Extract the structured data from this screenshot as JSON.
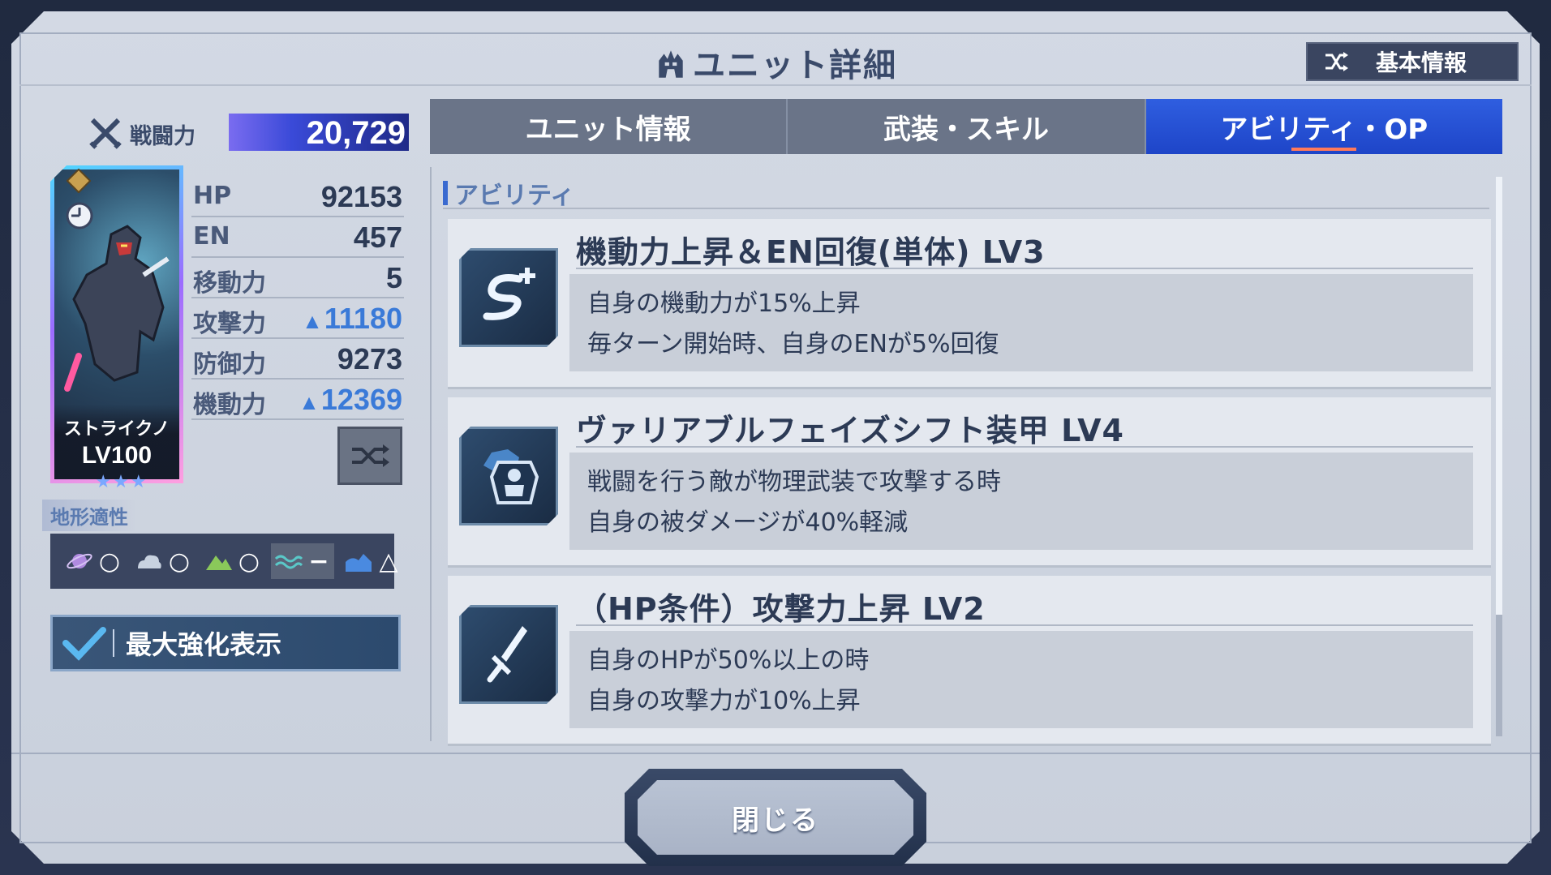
{
  "header": {
    "title": "ユニット詳細",
    "basic_info_label": "基本情報"
  },
  "power": {
    "label": "戦闘力",
    "value": "20,729"
  },
  "unit": {
    "name": "ストライクノ",
    "level": "LV100",
    "stars": "★★★"
  },
  "stats": [
    {
      "label": "HP",
      "value": "92153",
      "boosted": false
    },
    {
      "label": "EN",
      "value": "457",
      "boosted": false
    },
    {
      "label": "移動力",
      "value": "5",
      "boosted": false
    },
    {
      "label": "攻撃力",
      "value": "11180",
      "boosted": true
    },
    {
      "label": "防御力",
      "value": "9273",
      "boosted": false
    },
    {
      "label": "機動力",
      "value": "12369",
      "boosted": true
    }
  ],
  "terrain": {
    "label": "地形適性",
    "items": [
      {
        "icon": "space-icon",
        "mark": "○"
      },
      {
        "icon": "air-icon",
        "mark": "○"
      },
      {
        "icon": "ground-icon",
        "mark": "○"
      },
      {
        "icon": "water-icon",
        "mark": "−"
      },
      {
        "icon": "underwater-icon",
        "mark": "△"
      }
    ]
  },
  "max_enhance_label": "最大強化表示",
  "tabs": [
    {
      "label": "ユニット情報",
      "active": false
    },
    {
      "label": "武装・スキル",
      "active": false
    },
    {
      "label": "アビリティ・OP",
      "active": true
    }
  ],
  "section_title": "アビリティ",
  "abilities": [
    {
      "title": "機動力上昇＆EN回復(単体) LV3",
      "icon": "mobility-plus-icon",
      "lines": [
        "自身の機動力が15%上昇",
        "毎ターン開始時、自身のENが5%回復"
      ]
    },
    {
      "title": "ヴァリアブルフェイズシフト装甲 LV4",
      "icon": "armor-shield-icon",
      "lines": [
        "戦闘を行う敵が物理武装で攻撃する時",
        "自身の被ダメージが40%軽減"
      ]
    },
    {
      "title": "（HP条件）攻撃力上昇 LV2",
      "icon": "sword-icon",
      "lines": [
        "自身のHPが50%以上の時",
        "自身の攻撃力が10%上昇"
      ]
    }
  ],
  "close_label": "閉じる",
  "colors": {
    "active_tab": "#1e45c8",
    "boost_value": "#3a7ad8",
    "panel_bg": "#d3d9e4",
    "frame_bg": "#202a40"
  }
}
